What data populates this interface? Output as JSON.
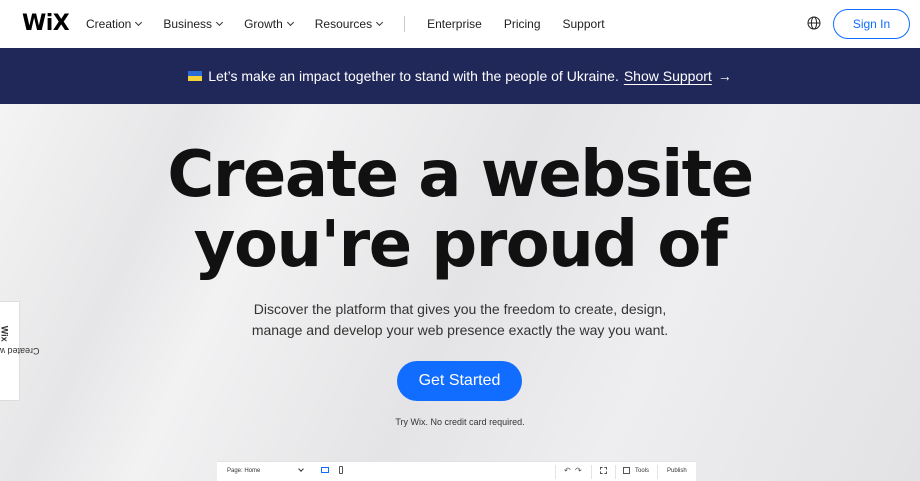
{
  "header": {
    "logo": "WiX",
    "nav": [
      {
        "label": "Creation",
        "has_dropdown": true
      },
      {
        "label": "Business",
        "has_dropdown": true
      },
      {
        "label": "Growth",
        "has_dropdown": true
      },
      {
        "label": "Resources",
        "has_dropdown": true
      },
      {
        "label": "Enterprise",
        "has_dropdown": false
      },
      {
        "label": "Pricing",
        "has_dropdown": false
      },
      {
        "label": "Support",
        "has_dropdown": false
      }
    ],
    "globe_icon": "globe-icon",
    "sign_in": "Sign In"
  },
  "banner": {
    "flag_icon": "ukraine-flag-icon",
    "text": "Let’s make an impact together to stand with the people of Ukraine.",
    "link": "Show Support",
    "arrow": "→"
  },
  "hero": {
    "title_line1": "Create a website",
    "title_line2": "you're proud of",
    "subtitle_line1": "Discover the platform that gives you the freedom to create, design,",
    "subtitle_line2": "manage and develop your web presence exactly the way you want.",
    "cta": "Get Started",
    "note": "Try Wix. No credit card required."
  },
  "side_tab": {
    "prefix": "Created with",
    "brand": "Wix"
  },
  "editor_bar": {
    "page_select": "Page: Home",
    "undo": "↶",
    "redo": "↷",
    "tools": "Tools",
    "publish": "Publish"
  },
  "colors": {
    "accent": "#116dff",
    "banner_bg": "#20285a",
    "ukraine_blue": "#2a6dd6",
    "ukraine_yellow": "#f6d23a"
  }
}
